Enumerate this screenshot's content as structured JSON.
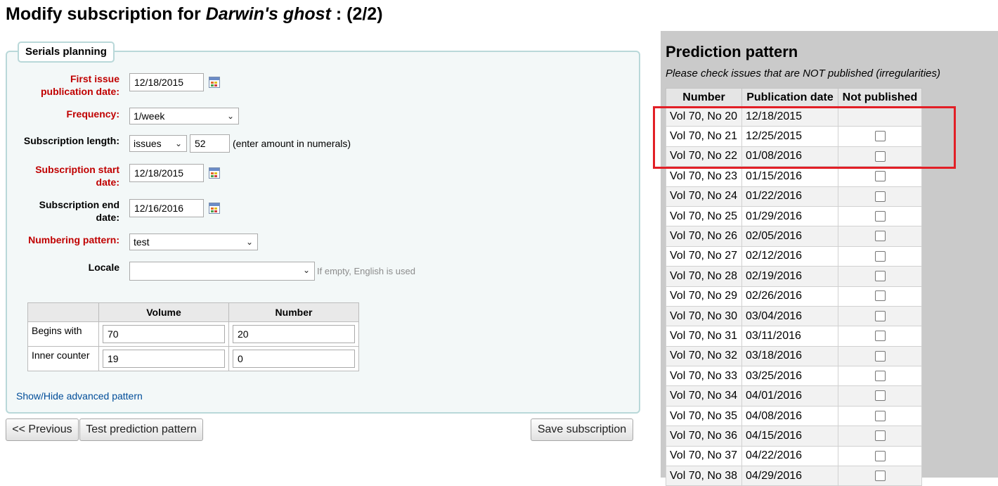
{
  "page": {
    "title_prefix": "Modify subscription for ",
    "title_name": "Darwin's ghost",
    "title_suffix": " : (2/2)"
  },
  "planning": {
    "legend": "Serials planning",
    "first_issue_label": "First issue publication date:",
    "first_issue_value": "12/18/2015",
    "frequency_label": "Frequency:",
    "frequency_value": "1/week",
    "sub_length_label": "Subscription length:",
    "sub_length_unit": "issues",
    "sub_length_value": "52",
    "sub_length_note": "(enter amount in numerals)",
    "start_label": "Subscription start date:",
    "start_value": "12/18/2015",
    "end_label": "Subscription end date:",
    "end_value": "12/16/2016",
    "numbering_label": "Numbering pattern:",
    "numbering_value": "test",
    "locale_label": "Locale",
    "locale_value": "",
    "locale_hint": "If empty, English is used",
    "pattern_table": {
      "headers": [
        "",
        "Volume",
        "Number"
      ],
      "rows": [
        {
          "label": "Begins with",
          "volume": "70",
          "number": "20"
        },
        {
          "label": "Inner counter",
          "volume": "19",
          "number": "0"
        }
      ]
    },
    "advanced_link": "Show/Hide advanced pattern"
  },
  "buttons": {
    "previous": "<< Previous",
    "test": "Test prediction pattern",
    "save": "Save subscription"
  },
  "prediction": {
    "title": "Prediction pattern",
    "subtitle": "Please check issues that are NOT published (irregularities)",
    "headers": [
      "Number",
      "Publication date",
      "Not published"
    ],
    "rows": [
      {
        "number": "Vol 70, No 20",
        "date": "12/18/2015",
        "checkbox": false
      },
      {
        "number": "Vol 70, No 21",
        "date": "12/25/2015",
        "checkbox": true
      },
      {
        "number": "Vol 70, No 22",
        "date": "01/08/2016",
        "checkbox": true
      },
      {
        "number": "Vol 70, No 23",
        "date": "01/15/2016",
        "checkbox": true
      },
      {
        "number": "Vol 70, No 24",
        "date": "01/22/2016",
        "checkbox": true
      },
      {
        "number": "Vol 70, No 25",
        "date": "01/29/2016",
        "checkbox": true
      },
      {
        "number": "Vol 70, No 26",
        "date": "02/05/2016",
        "checkbox": true
      },
      {
        "number": "Vol 70, No 27",
        "date": "02/12/2016",
        "checkbox": true
      },
      {
        "number": "Vol 70, No 28",
        "date": "02/19/2016",
        "checkbox": true
      },
      {
        "number": "Vol 70, No 29",
        "date": "02/26/2016",
        "checkbox": true
      },
      {
        "number": "Vol 70, No 30",
        "date": "03/04/2016",
        "checkbox": true
      },
      {
        "number": "Vol 70, No 31",
        "date": "03/11/2016",
        "checkbox": true
      },
      {
        "number": "Vol 70, No 32",
        "date": "03/18/2016",
        "checkbox": true
      },
      {
        "number": "Vol 70, No 33",
        "date": "03/25/2016",
        "checkbox": true
      },
      {
        "number": "Vol 70, No 34",
        "date": "04/01/2016",
        "checkbox": true
      },
      {
        "number": "Vol 70, No 35",
        "date": "04/08/2016",
        "checkbox": true
      },
      {
        "number": "Vol 70, No 36",
        "date": "04/15/2016",
        "checkbox": true
      },
      {
        "number": "Vol 70, No 37",
        "date": "04/22/2016",
        "checkbox": true
      },
      {
        "number": "Vol 70, No 38",
        "date": "04/29/2016",
        "checkbox": true
      }
    ]
  },
  "colors": {
    "required_label": "#c00000",
    "fieldset_bg": "#f3f8f8",
    "fieldset_border": "#b9d8d9",
    "panel_bg": "#cacaca",
    "link": "#004d99",
    "highlight_box": "#e21f26"
  }
}
